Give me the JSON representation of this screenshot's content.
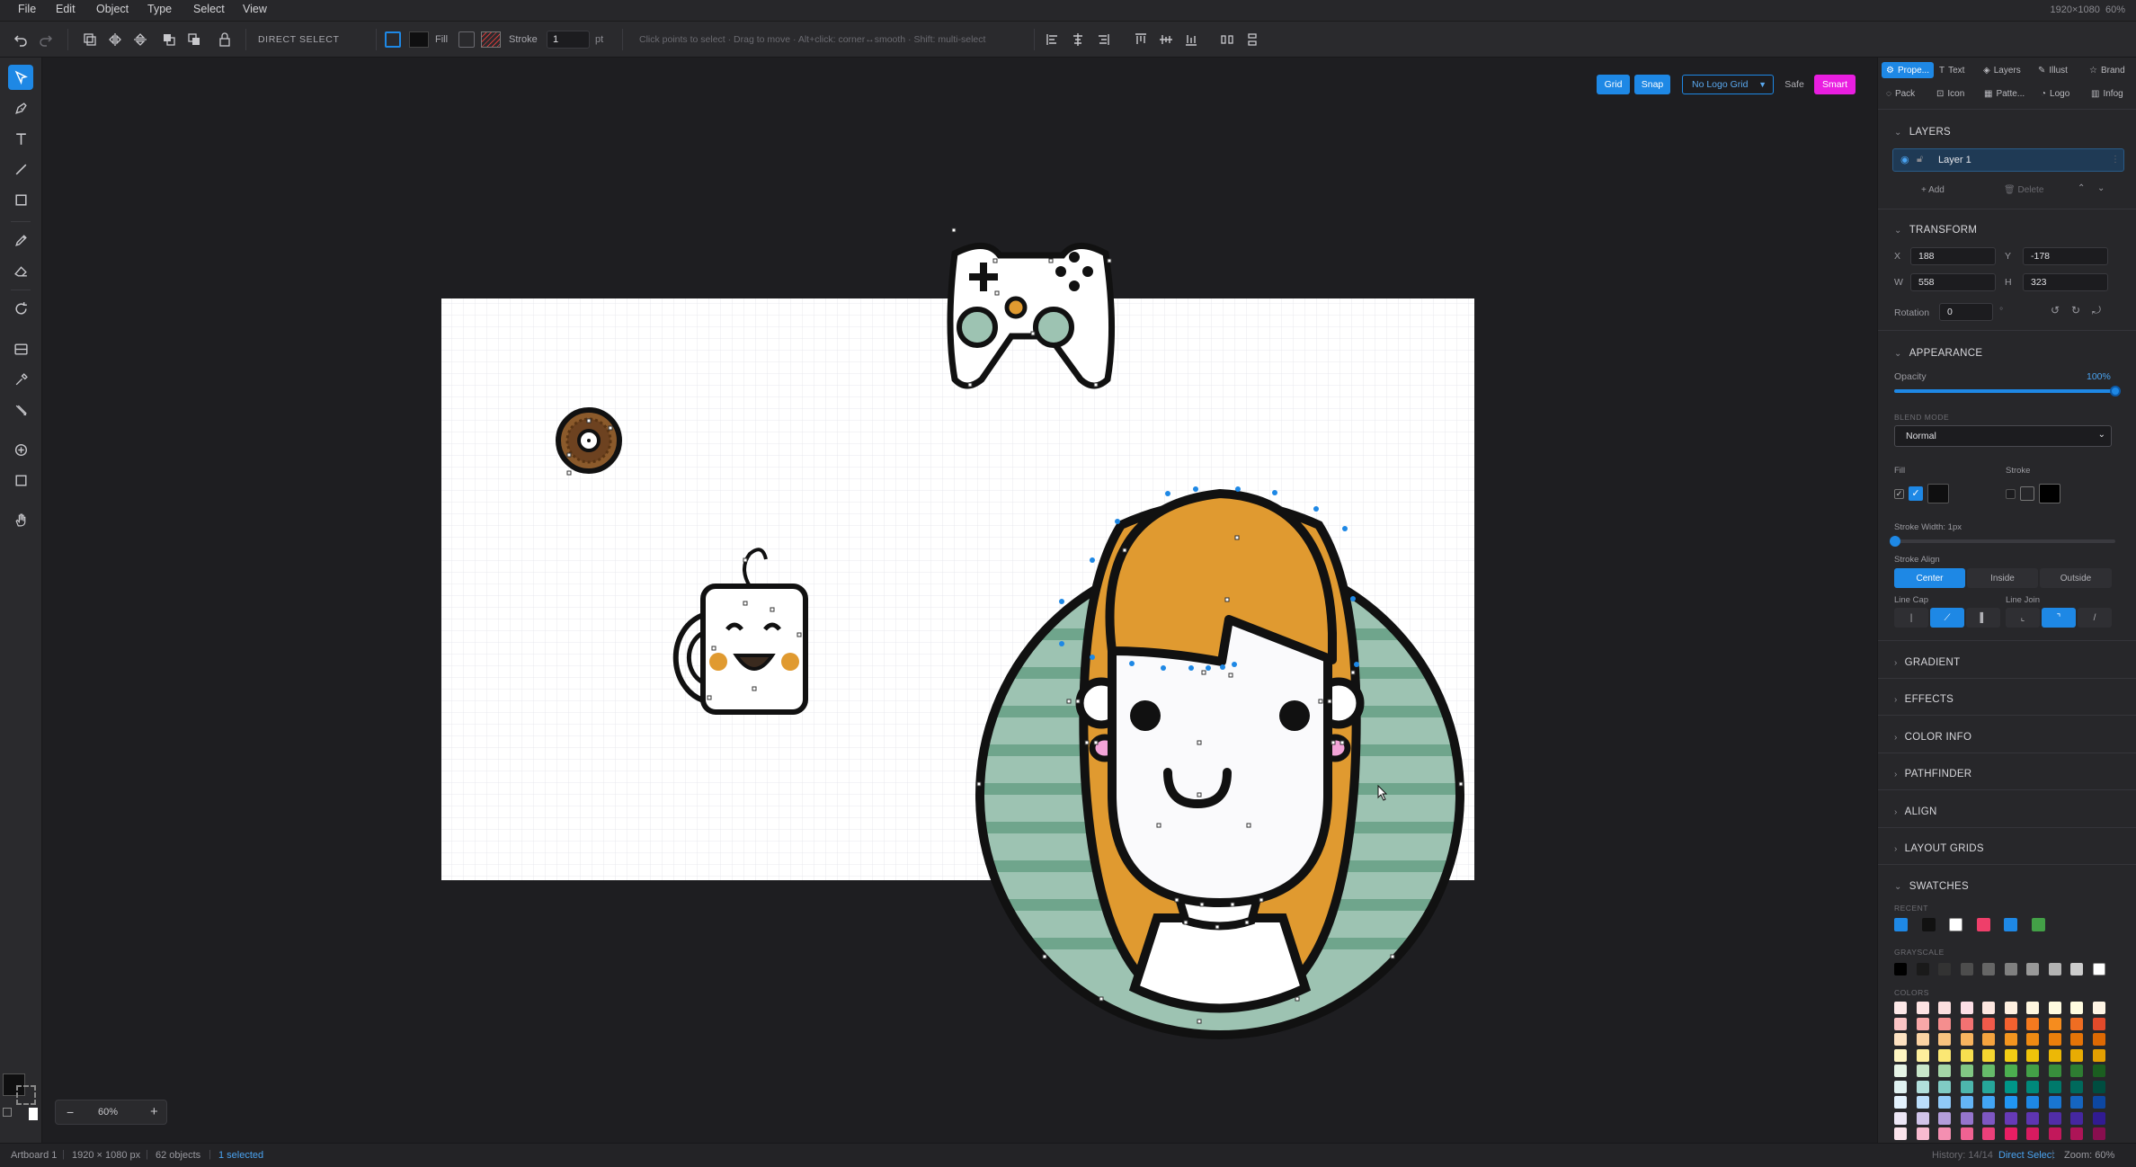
{
  "menu": {
    "file": "File",
    "edit": "Edit",
    "object": "Object",
    "type": "Type",
    "select": "Select",
    "view": "View"
  },
  "doc_info": {
    "size": "1920×1080",
    "zoom": "60%"
  },
  "toolbar": {
    "mode_label": "DIRECT SELECT",
    "fill_label": "Fill",
    "stroke_label": "Stroke",
    "stroke_value": "1",
    "stroke_unit": "pt",
    "hint": "Click points to select · Drag to move · Alt+click: corner↔smooth · Shift: multi-select"
  },
  "canvas_controls": {
    "grid": "Grid",
    "snap": "Snap",
    "logo_grid": "No Logo Grid",
    "safe": "Safe",
    "smart": "Smart"
  },
  "zoom": {
    "minus": "−",
    "value": "60%",
    "plus": "+"
  },
  "panel_tabs": {
    "row1": [
      "Prope...",
      "Text",
      "Layers",
      "Illust",
      "Brand"
    ],
    "row2": [
      "Pack",
      "Icon",
      "Patte...",
      "Logo",
      "Infog"
    ]
  },
  "layers": {
    "title": "LAYERS",
    "layer_name": "Layer 1",
    "add": "Add",
    "delete": "Delete"
  },
  "transform": {
    "title": "TRANSFORM",
    "x_label": "X",
    "x": "188",
    "y_label": "Y",
    "y": "-178",
    "w_label": "W",
    "w": "558",
    "h_label": "H",
    "h": "323",
    "rotation_label": "Rotation",
    "rotation": "0",
    "deg": "°"
  },
  "appearance": {
    "title": "APPEARANCE",
    "opacity_label": "Opacity",
    "opacity_value": "100%",
    "opacity": 1.0,
    "blend_label": "BLEND MODE",
    "blend": "Normal",
    "fill_label": "Fill",
    "stroke_label": "Stroke",
    "stroke_width_label": "Stroke Width: 1px",
    "stroke_align_label": "Stroke Align",
    "align_center": "Center",
    "align_inside": "Inside",
    "align_outside": "Outside",
    "line_cap_label": "Line Cap",
    "line_join_label": "Line Join"
  },
  "collapsed": {
    "gradient": "GRADIENT",
    "effects": "EFFECTS",
    "color_info": "COLOR INFO",
    "pathfinder": "PATHFINDER",
    "align": "ALIGN",
    "layout_grids": "LAYOUT GRIDS"
  },
  "swatches": {
    "title": "SWATCHES",
    "recent_label": "RECENT",
    "grayscale_label": "GRAYSCALE",
    "colors_label": "COLORS",
    "recent": [
      "#1e88e5",
      "#111111",
      "#ffffff",
      "#ef3f6a",
      "#1e88e5",
      "#43a047"
    ],
    "grayscale": [
      "#000000",
      "#1a1a1a",
      "#333333",
      "#4d4d4d",
      "#666666",
      "#808080",
      "#999999",
      "#b3b3b3",
      "#cccccc",
      "#ffffff"
    ],
    "colors": [
      [
        "#fde8e8",
        "#fde3e3",
        "#fcdede",
        "#fddfe6",
        "#fde7e0",
        "#fff0e0",
        "#fff7df",
        "#fffbe0",
        "#fffce0",
        "#fff5e5"
      ],
      [
        "#fbc4c4",
        "#f9a8a8",
        "#f58e8e",
        "#f27272",
        "#f15a4a",
        "#f4612f",
        "#f57a1f",
        "#f68c1e",
        "#ef6d22",
        "#e34a2a"
      ],
      [
        "#fde2c2",
        "#fbd3a3",
        "#f9c37f",
        "#f7b45f",
        "#f5a43f",
        "#f3951f",
        "#ef8a12",
        "#eb7f0b",
        "#e57407",
        "#de6903"
      ],
      [
        "#fff6c2",
        "#fdee9c",
        "#fbe774",
        "#f8df4f",
        "#f5d630",
        "#f2cd14",
        "#efc30a",
        "#ecb806",
        "#e8ac03",
        "#e39f01"
      ],
      [
        "#e6f4e6",
        "#c8e6c9",
        "#a5d6a7",
        "#81c784",
        "#66bb6a",
        "#4caf50",
        "#43a047",
        "#388e3c",
        "#2e7d32",
        "#1b5e20"
      ],
      [
        "#e0f2f1",
        "#b2dfdb",
        "#80cbc4",
        "#4db6ac",
        "#26a69a",
        "#009688",
        "#00897b",
        "#00796b",
        "#00695c",
        "#004d40"
      ],
      [
        "#e3f2fd",
        "#bbdefb",
        "#90caf9",
        "#64b5f6",
        "#42a5f5",
        "#2196f3",
        "#1e88e5",
        "#1976d2",
        "#1565c0",
        "#0d47a1"
      ],
      [
        "#ede7f6",
        "#d1c4e9",
        "#b39ddb",
        "#9575cd",
        "#7e57c2",
        "#673ab7",
        "#5e35b1",
        "#512da8",
        "#4527a0",
        "#311b92"
      ],
      [
        "#fce4ec",
        "#f8bbd0",
        "#f48fb1",
        "#f06292",
        "#ec407a",
        "#e91e63",
        "#d81b60",
        "#c2185b",
        "#ad1457",
        "#880e4f"
      ]
    ]
  },
  "status": {
    "artboard": "Artboard 1",
    "size": "1920 × 1080 px",
    "objects": "62 objects",
    "selected": "1 selected",
    "history": "History: 14/14",
    "tool": "Direct Select",
    "zoom": "Zoom: 60%"
  }
}
